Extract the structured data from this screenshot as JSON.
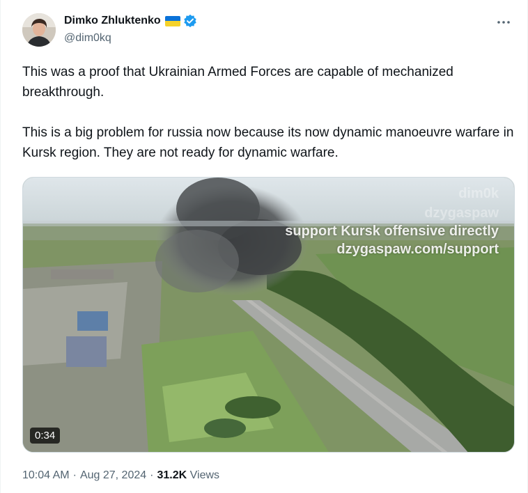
{
  "author": {
    "name": "Dimko Zhluktenko",
    "handle": "@dim0kq",
    "flag_colors": [
      "#0a72d8",
      "#f5d22a"
    ],
    "verified": true,
    "badge_color": "#1d9bf0"
  },
  "more_icon": "more-dots-icon",
  "tweet": {
    "paragraphs": [
      "This was a proof that Ukrainian Armed Forces are capable of mechanized breakthrough.",
      "This is a big problem for russia now because its now dynamic manoeuvre warfare in Kursk region. They are not ready for dynamic warfare."
    ]
  },
  "media": {
    "watermark_1": "dim0k",
    "watermark_2": "dzygaspaw",
    "overlay_line_1": "support Kursk offensive directly",
    "overlay_line_2": "dzygaspaw.com/support",
    "duration": "0:34"
  },
  "meta": {
    "time": "10:04 AM",
    "date": "Aug 27, 2024",
    "views_count": "31.2K",
    "views_label": "Views",
    "separator": "·"
  }
}
